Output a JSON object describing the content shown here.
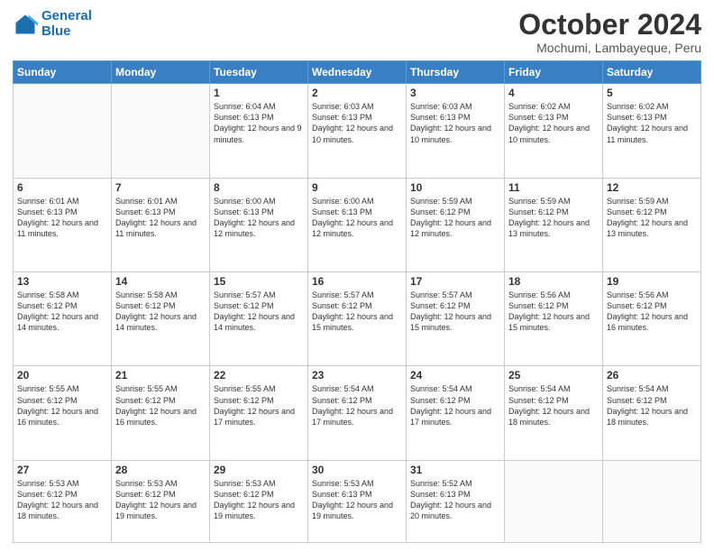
{
  "logo": {
    "line1": "General",
    "line2": "Blue"
  },
  "header": {
    "title": "October 2024",
    "subtitle": "Mochumi, Lambayeque, Peru"
  },
  "weekdays": [
    "Sunday",
    "Monday",
    "Tuesday",
    "Wednesday",
    "Thursday",
    "Friday",
    "Saturday"
  ],
  "weeks": [
    [
      {
        "day": null,
        "info": null
      },
      {
        "day": null,
        "info": null
      },
      {
        "day": "1",
        "sunrise": "6:04 AM",
        "sunset": "6:13 PM",
        "daylight": "12 hours and 9 minutes."
      },
      {
        "day": "2",
        "sunrise": "6:03 AM",
        "sunset": "6:13 PM",
        "daylight": "12 hours and 10 minutes."
      },
      {
        "day": "3",
        "sunrise": "6:03 AM",
        "sunset": "6:13 PM",
        "daylight": "12 hours and 10 minutes."
      },
      {
        "day": "4",
        "sunrise": "6:02 AM",
        "sunset": "6:13 PM",
        "daylight": "12 hours and 10 minutes."
      },
      {
        "day": "5",
        "sunrise": "6:02 AM",
        "sunset": "6:13 PM",
        "daylight": "12 hours and 11 minutes."
      }
    ],
    [
      {
        "day": "6",
        "sunrise": "6:01 AM",
        "sunset": "6:13 PM",
        "daylight": "12 hours and 11 minutes."
      },
      {
        "day": "7",
        "sunrise": "6:01 AM",
        "sunset": "6:13 PM",
        "daylight": "12 hours and 11 minutes."
      },
      {
        "day": "8",
        "sunrise": "6:00 AM",
        "sunset": "6:13 PM",
        "daylight": "12 hours and 12 minutes."
      },
      {
        "day": "9",
        "sunrise": "6:00 AM",
        "sunset": "6:13 PM",
        "daylight": "12 hours and 12 minutes."
      },
      {
        "day": "10",
        "sunrise": "5:59 AM",
        "sunset": "6:12 PM",
        "daylight": "12 hours and 12 minutes."
      },
      {
        "day": "11",
        "sunrise": "5:59 AM",
        "sunset": "6:12 PM",
        "daylight": "12 hours and 13 minutes."
      },
      {
        "day": "12",
        "sunrise": "5:59 AM",
        "sunset": "6:12 PM",
        "daylight": "12 hours and 13 minutes."
      }
    ],
    [
      {
        "day": "13",
        "sunrise": "5:58 AM",
        "sunset": "6:12 PM",
        "daylight": "12 hours and 14 minutes."
      },
      {
        "day": "14",
        "sunrise": "5:58 AM",
        "sunset": "6:12 PM",
        "daylight": "12 hours and 14 minutes."
      },
      {
        "day": "15",
        "sunrise": "5:57 AM",
        "sunset": "6:12 PM",
        "daylight": "12 hours and 14 minutes."
      },
      {
        "day": "16",
        "sunrise": "5:57 AM",
        "sunset": "6:12 PM",
        "daylight": "12 hours and 15 minutes."
      },
      {
        "day": "17",
        "sunrise": "5:57 AM",
        "sunset": "6:12 PM",
        "daylight": "12 hours and 15 minutes."
      },
      {
        "day": "18",
        "sunrise": "5:56 AM",
        "sunset": "6:12 PM",
        "daylight": "12 hours and 15 minutes."
      },
      {
        "day": "19",
        "sunrise": "5:56 AM",
        "sunset": "6:12 PM",
        "daylight": "12 hours and 16 minutes."
      }
    ],
    [
      {
        "day": "20",
        "sunrise": "5:55 AM",
        "sunset": "6:12 PM",
        "daylight": "12 hours and 16 minutes."
      },
      {
        "day": "21",
        "sunrise": "5:55 AM",
        "sunset": "6:12 PM",
        "daylight": "12 hours and 16 minutes."
      },
      {
        "day": "22",
        "sunrise": "5:55 AM",
        "sunset": "6:12 PM",
        "daylight": "12 hours and 17 minutes."
      },
      {
        "day": "23",
        "sunrise": "5:54 AM",
        "sunset": "6:12 PM",
        "daylight": "12 hours and 17 minutes."
      },
      {
        "day": "24",
        "sunrise": "5:54 AM",
        "sunset": "6:12 PM",
        "daylight": "12 hours and 17 minutes."
      },
      {
        "day": "25",
        "sunrise": "5:54 AM",
        "sunset": "6:12 PM",
        "daylight": "12 hours and 18 minutes."
      },
      {
        "day": "26",
        "sunrise": "5:54 AM",
        "sunset": "6:12 PM",
        "daylight": "12 hours and 18 minutes."
      }
    ],
    [
      {
        "day": "27",
        "sunrise": "5:53 AM",
        "sunset": "6:12 PM",
        "daylight": "12 hours and 18 minutes."
      },
      {
        "day": "28",
        "sunrise": "5:53 AM",
        "sunset": "6:12 PM",
        "daylight": "12 hours and 19 minutes."
      },
      {
        "day": "29",
        "sunrise": "5:53 AM",
        "sunset": "6:12 PM",
        "daylight": "12 hours and 19 minutes."
      },
      {
        "day": "30",
        "sunrise": "5:53 AM",
        "sunset": "6:13 PM",
        "daylight": "12 hours and 19 minutes."
      },
      {
        "day": "31",
        "sunrise": "5:52 AM",
        "sunset": "6:13 PM",
        "daylight": "12 hours and 20 minutes."
      },
      {
        "day": null,
        "info": null
      },
      {
        "day": null,
        "info": null
      }
    ]
  ]
}
